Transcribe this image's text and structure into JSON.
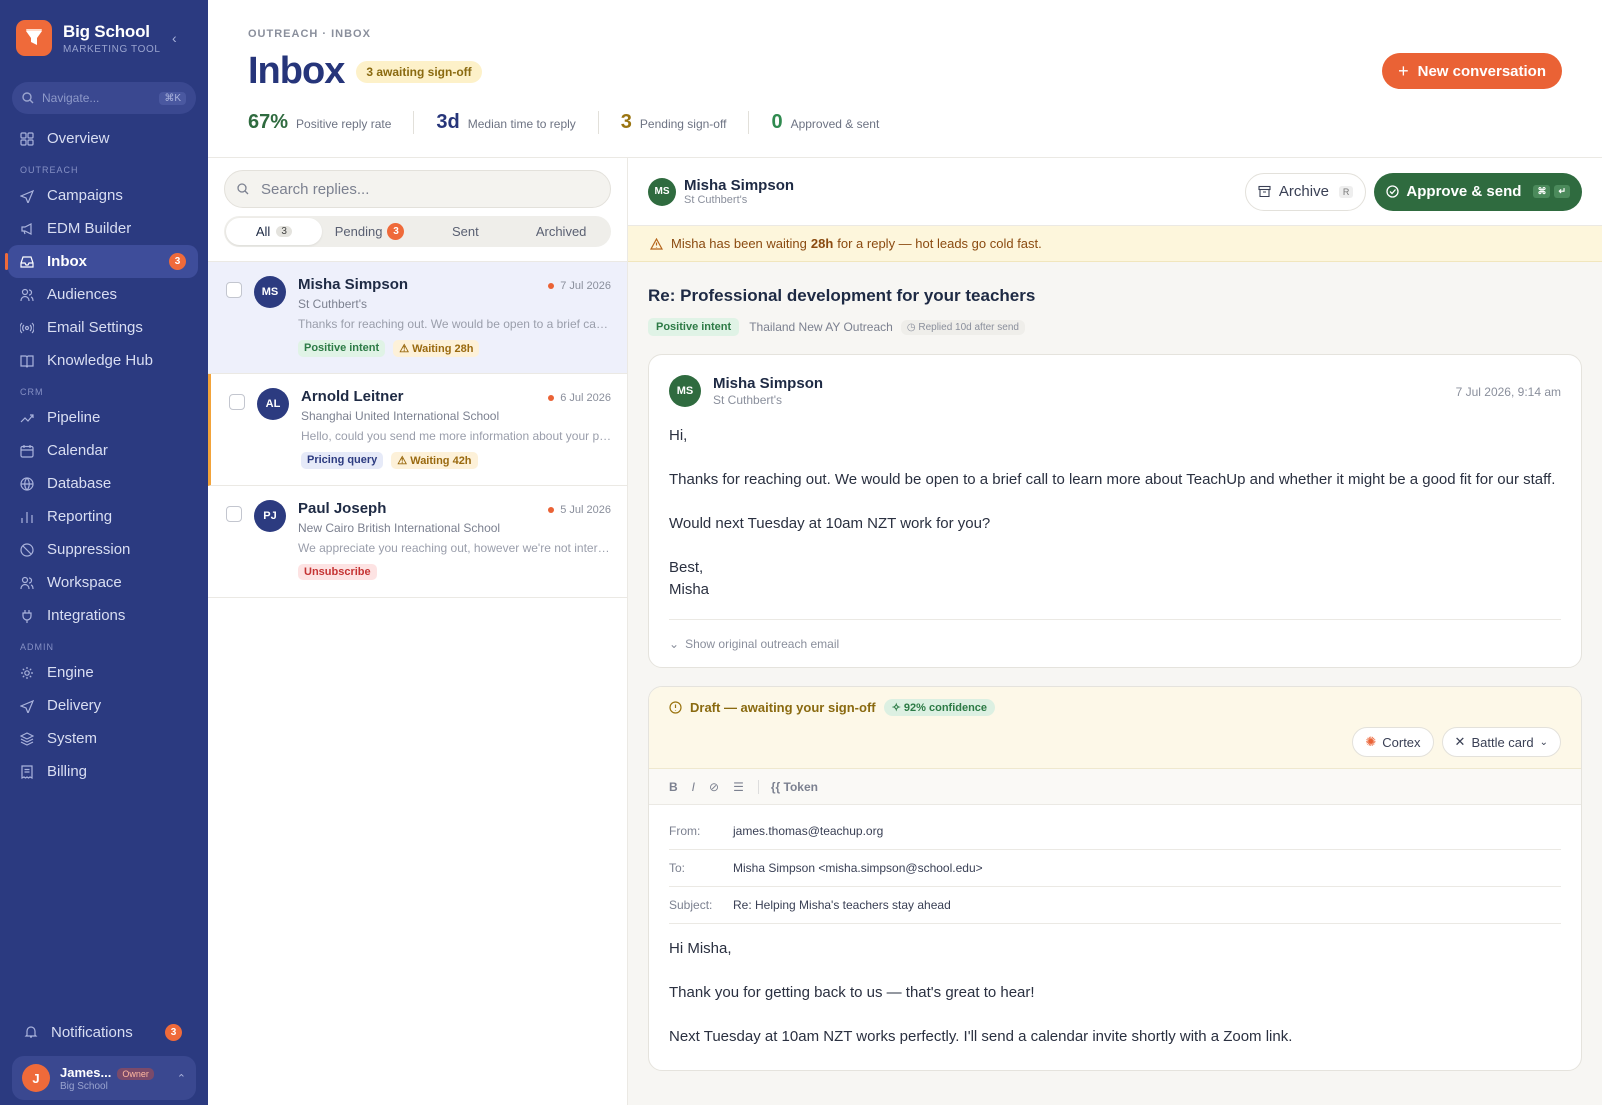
{
  "sidebar": {
    "brand": {
      "name": "Big School",
      "sub": "MARKETING TOOL"
    },
    "search": {
      "placeholder": "Navigate...",
      "shortcut": "⌘K"
    },
    "items": [
      {
        "label": "Overview",
        "icon": "grid-icon"
      },
      {
        "section": "OUTREACH"
      },
      {
        "label": "Campaigns",
        "icon": "send-icon"
      },
      {
        "label": "EDM Builder",
        "icon": "megaphone-icon"
      },
      {
        "label": "Inbox",
        "icon": "inbox-icon",
        "badge": "3",
        "active": true
      },
      {
        "label": "Audiences",
        "icon": "users-icon"
      },
      {
        "label": "Email Settings",
        "icon": "signal-icon"
      },
      {
        "label": "Knowledge Hub",
        "icon": "book-icon"
      },
      {
        "section": "CRM"
      },
      {
        "label": "Pipeline",
        "icon": "trend-icon"
      },
      {
        "label": "Calendar",
        "icon": "calendar-icon"
      },
      {
        "label": "Database",
        "icon": "globe-icon"
      },
      {
        "label": "Reporting",
        "icon": "bar-chart-icon"
      },
      {
        "label": "Suppression",
        "icon": "ban-icon"
      },
      {
        "label": "Workspace",
        "icon": "users-icon"
      },
      {
        "label": "Integrations",
        "icon": "plug-icon"
      },
      {
        "section": "ADMIN"
      },
      {
        "label": "Engine",
        "icon": "gear-icon"
      },
      {
        "label": "Delivery",
        "icon": "send-icon"
      },
      {
        "label": "System",
        "icon": "layers-icon"
      },
      {
        "label": "Billing",
        "icon": "receipt-icon"
      }
    ],
    "notifications": {
      "label": "Notifications",
      "badge": "3"
    },
    "user": {
      "initial": "J",
      "name": "James...",
      "role": "Owner",
      "org": "Big School"
    }
  },
  "header": {
    "breadcrumb": "OUTREACH · INBOX",
    "title": "Inbox",
    "awaiting_badge": "3 awaiting sign-off",
    "new_button": "New conversation",
    "stats": [
      {
        "value": "67%",
        "label": "Positive reply rate",
        "color": "#2f6b3f"
      },
      {
        "value": "3d",
        "label": "Median time to reply",
        "color": "#26357a"
      },
      {
        "value": "3",
        "label": "Pending sign-off",
        "color": "#9a7410"
      },
      {
        "value": "0",
        "label": "Approved & sent",
        "color": "#2f8a4f"
      }
    ]
  },
  "list": {
    "search_placeholder": "Search replies...",
    "tabs": [
      {
        "label": "All",
        "count": "3"
      },
      {
        "label": "Pending",
        "badge": "3"
      },
      {
        "label": "Sent"
      },
      {
        "label": "Archived"
      }
    ],
    "rows": [
      {
        "initials": "MS",
        "name": "Misha Simpson",
        "date": "7 Jul 2026",
        "org": "St Cuthbert's",
        "preview": "Thanks for reaching out. We would be open to a brief call to learn more about TeachUp",
        "tags": [
          {
            "text": "Positive intent",
            "kind": "green"
          },
          {
            "text": "Waiting 28h",
            "kind": "amber"
          }
        ]
      },
      {
        "initials": "AL",
        "name": "Arnold Leitner",
        "date": "6 Jul 2026",
        "org": "Shanghai United International School",
        "preview": "Hello, could you send me more information about your pricing options",
        "tags": [
          {
            "text": "Pricing query",
            "kind": "blue"
          },
          {
            "text": "Waiting 42h",
            "kind": "amber"
          }
        ]
      },
      {
        "initials": "PJ",
        "name": "Paul Joseph",
        "date": "5 Jul 2026",
        "org": "New Cairo British International School",
        "preview": "We appreciate you reaching out, however we're not interested at this time",
        "tags": [
          {
            "text": "Unsubscribe",
            "kind": "red"
          }
        ]
      }
    ]
  },
  "detail": {
    "contact": {
      "initials": "MS",
      "name": "Misha Simpson",
      "org": "St Cuthbert's"
    },
    "archive": {
      "label": "Archive",
      "key": "R"
    },
    "approve": {
      "label": "Approve & send",
      "key1": "⌘",
      "key2": "↵"
    },
    "alert": {
      "pre": "Misha has been waiting",
      "bold": "28h",
      "post": "for a reply — hot leads go cold fast."
    },
    "subject": "Re: Professional development for your teachers",
    "intent": "Positive intent",
    "campaign": "Thailand New AY Outreach",
    "replied": "Replied 10d after send",
    "message": {
      "initials": "MS",
      "name": "Misha Simpson",
      "org": "St Cuthbert's",
      "date": "7 Jul 2026, 9:14 am",
      "p1": "Hi,",
      "p2": "Thanks for reaching out. We would be open to a brief call to learn more about TeachUp and whether it might be a good fit for our staff.",
      "p3": "Would next Tuesday at 10am NZT work for you?",
      "p4a": "Best,",
      "p4b": "Misha",
      "show_original": "Show original outreach email"
    },
    "draft": {
      "status": "Draft — awaiting your sign-off",
      "confidence": "92% confidence",
      "cortex": "Cortex",
      "battle": "Battle card",
      "token": "Token",
      "from_label": "From:",
      "from": "james.thomas@teachup.org",
      "to_label": "To:",
      "to": "Misha Simpson <misha.simpson@school.edu>",
      "subject_label": "Subject:",
      "subject": "Re: Helping Misha's teachers stay ahead",
      "b1": "Hi Misha,",
      "b2": "Thank you for getting back to us — that's great to hear!",
      "b3": "Next Tuesday at 10am NZT works perfectly. I'll send a calendar invite shortly with a Zoom link."
    }
  },
  "colors": {
    "sidebar": "#2b3a80",
    "accent": "#ea6235",
    "approve": "#2f6b3f"
  }
}
